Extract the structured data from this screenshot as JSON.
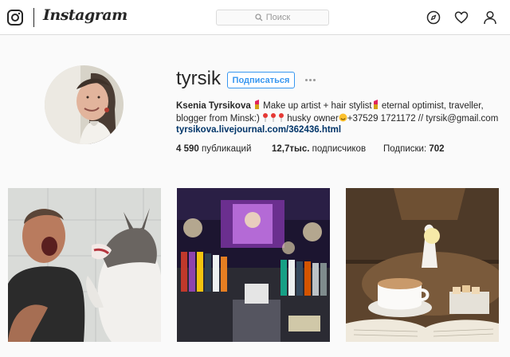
{
  "header": {
    "wordmark": "Instagram",
    "search_placeholder": "Поиск",
    "icons": [
      "instagram-glyph-icon",
      "compass-icon",
      "heart-icon",
      "person-icon"
    ]
  },
  "profile": {
    "username": "tyrsik",
    "follow_label": "Подписаться",
    "full_name": "Ksenia Tyrsikova",
    "bio_line1": " Make up artist + hair stylist",
    "bio_line1b": " eternal optimist, traveller,",
    "bio_line2": "blogger from Minsk:) ",
    "bio_line2b": " husky owner",
    "bio_line2c": "+37529 1721172 // tyrsik@gmail.com",
    "link": "tyrsikova.livejournal.com/362436.html"
  },
  "stats": {
    "posts_value": "4 590",
    "posts_label": " публикаций",
    "followers_value": "12,7тыс.",
    "followers_label": " подписчиков",
    "following_label": "Подписки: ",
    "following_value": "702"
  },
  "posts": [
    {
      "subject": "man-and-husky"
    },
    {
      "subject": "clothing-store"
    },
    {
      "subject": "coffee-and-book"
    }
  ],
  "colors": {
    "accent": "#3897f0",
    "link": "#003569",
    "border": "#dbdbdb"
  }
}
